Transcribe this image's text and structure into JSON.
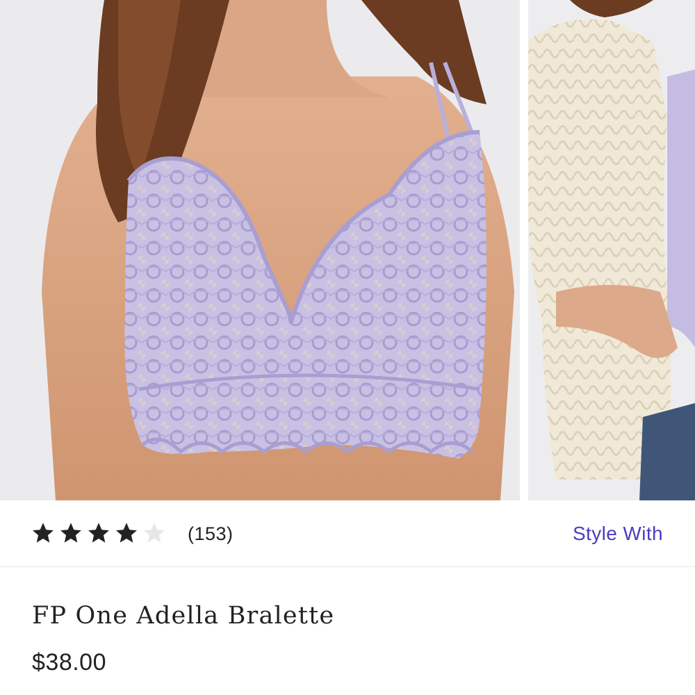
{
  "gallery": {
    "images": [
      {
        "name": "product-photo-bralette",
        "icon": "product-photo"
      },
      {
        "name": "product-photo-style-with-cardigan",
        "icon": "product-photo"
      }
    ]
  },
  "rating": {
    "stars_filled": 4,
    "stars_total": 5,
    "review_count": "(153)",
    "filled_color": "#222222",
    "empty_color": "#e7e7e7"
  },
  "style_with": {
    "label": "Style With",
    "color": "#4a3cc2"
  },
  "product": {
    "title": "FP One Adella Bralette",
    "price": "$38.00"
  }
}
